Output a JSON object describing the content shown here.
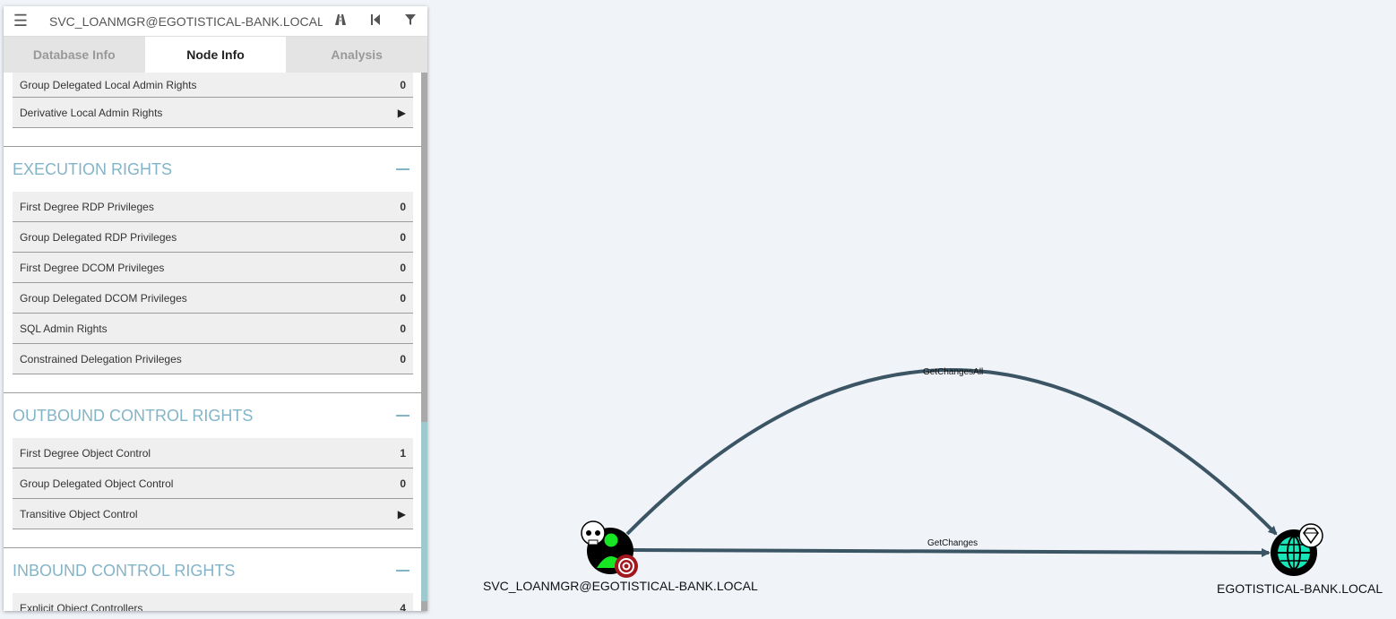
{
  "topbar": {
    "search_value": "SVC_LOANMGR@EGOTISTICAL-BANK.LOCAL",
    "menu_icon": "hamburger-icon",
    "pathfinding_icon": "road-icon",
    "back_icon": "step-back-icon",
    "filter_icon": "filter-icon"
  },
  "tabs": [
    {
      "label": "Database Info"
    },
    {
      "label": "Node Info"
    },
    {
      "label": "Analysis"
    }
  ],
  "partial_rows": [
    {
      "label": "Group Delegated Local Admin Rights",
      "value": "0"
    },
    {
      "label": "Derivative Local Admin Rights",
      "value": "▶"
    }
  ],
  "sections": [
    {
      "title": "EXECUTION RIGHTS",
      "rows": [
        {
          "label": "First Degree RDP Privileges",
          "value": "0"
        },
        {
          "label": "Group Delegated RDP Privileges",
          "value": "0"
        },
        {
          "label": "First Degree DCOM Privileges",
          "value": "0"
        },
        {
          "label": "Group Delegated DCOM Privileges",
          "value": "0"
        },
        {
          "label": "SQL Admin Rights",
          "value": "0"
        },
        {
          "label": "Constrained Delegation Privileges",
          "value": "0"
        }
      ]
    },
    {
      "title": "OUTBOUND CONTROL RIGHTS",
      "rows": [
        {
          "label": "First Degree Object Control",
          "value": "1"
        },
        {
          "label": "Group Delegated Object Control",
          "value": "0"
        },
        {
          "label": "Transitive Object Control",
          "value": "▶"
        }
      ]
    },
    {
      "title": "INBOUND CONTROL RIGHTS",
      "rows": [
        {
          "label": "Explicit Object Controllers",
          "value": "4"
        }
      ]
    }
  ],
  "graph": {
    "user_node_label": "SVC_LOANMGR@EGOTISTICAL-BANK.LOCAL",
    "domain_node_label": "EGOTISTICAL-BANK.LOCAL",
    "edge_top_label": "GetChangesAll",
    "edge_bottom_label": "GetChanges",
    "user_color": "#17e625",
    "domain_color": "#17e6b9",
    "edge_color": "#3b5565"
  }
}
